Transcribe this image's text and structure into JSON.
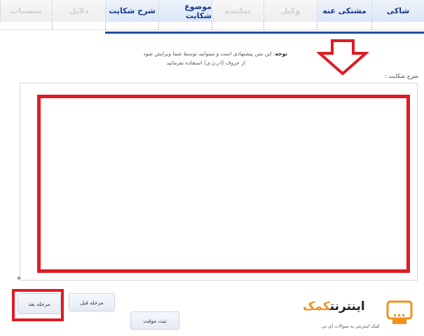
{
  "tabs": [
    {
      "label": "شاکی",
      "state": "active"
    },
    {
      "label": "مشتکی عنه",
      "state": "active"
    },
    {
      "label": "وکیل",
      "state": "disabled"
    },
    {
      "label": "نماینده",
      "state": "disabled"
    },
    {
      "label": "موضوع شکایت",
      "state": "active"
    },
    {
      "label": "شرح شکایت",
      "state": "active"
    },
    {
      "label": "دلایل",
      "state": "disabled"
    },
    {
      "label": "منضمات",
      "state": "disabled"
    }
  ],
  "notice": {
    "prefix": "توجه",
    "line1": ": این متن پیشنهادی است و میتوانید توسط شما ویرایش شود",
    "line2": "از حروف (ا،ر،ژ،ی) استفاده نفرمائید"
  },
  "description": {
    "label": "شرح شکایت :",
    "value": ""
  },
  "buttons": {
    "next": "مرحله بعد",
    "prev": "مرحله قبل",
    "submit": "ثبت موقت"
  },
  "watermark": {
    "brand_primary": "اینترنت",
    "brand_secondary": "کمک",
    "tagline": "کمک اینترنتی به سوالات آی تی"
  },
  "colors": {
    "highlight": "#e01b24",
    "tab_active_text": "#1a3a8a",
    "rule": "#1f4e9c",
    "brand_orange": "#f39019"
  }
}
